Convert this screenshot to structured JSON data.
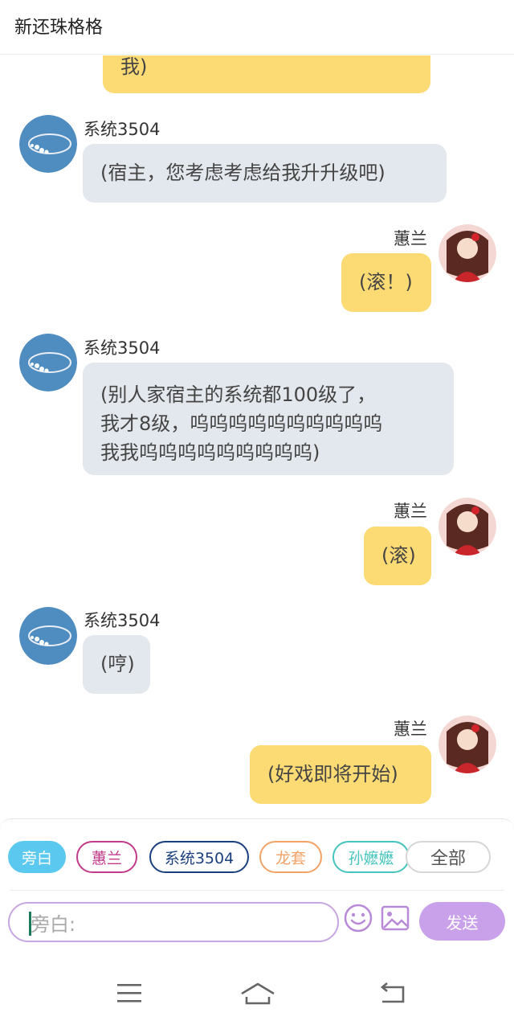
{
  "header": {
    "title": "新还珠格格"
  },
  "messages": [
    {
      "text": "我)"
    },
    {
      "sender": "系统3504",
      "text": "(宿主，您考虑考虑给我升升级吧)"
    },
    {
      "sender": "蕙兰",
      "text": "(滚！)"
    },
    {
      "sender": "系统3504",
      "lines": [
        "(别人家宿主的系统都100级了，",
        "我才8级，呜呜呜呜呜呜呜呜呜呜",
        "我我呜呜呜呜呜呜呜呜呜)"
      ]
    },
    {
      "sender": "蕙兰",
      "text": "(滚)"
    },
    {
      "sender": "系统3504",
      "text": "(哼)"
    },
    {
      "sender": "蕙兰",
      "text": "(好戏即将开始)"
    }
  ],
  "roles": {
    "narrator": "旁白",
    "huilan": "蕙兰",
    "system": "系统3504",
    "longtao": "龙套",
    "sun": "孙嬷嬷",
    "all": "全部"
  },
  "composer": {
    "placeholder": "旁白:",
    "send_label": "发送"
  },
  "colors": {
    "my_bubble": "#fcdb74",
    "system_bubble": "#e3e7ee",
    "send_button": "#c9a0ea",
    "narrator_chip": "#5bc8f0"
  },
  "icons": [
    "emoji-icon",
    "image-icon",
    "menu-icon",
    "home-icon",
    "back-icon",
    "bracelet-avatar",
    "huilan-avatar"
  ]
}
